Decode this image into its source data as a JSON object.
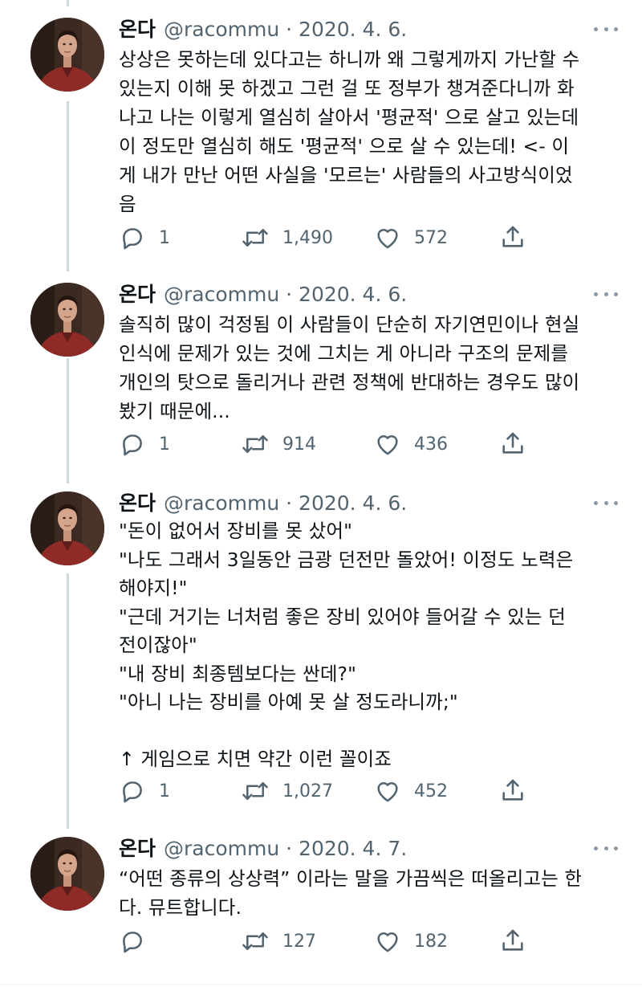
{
  "tweets": [
    {
      "name": "온다",
      "handle_date": "@racommu · 2020. 4. 6.",
      "text": "상상은 못하는데 있다고는 하니까 왜 그렇게까지 가난할 수\n있는지 이해 못 하겠고 그런 걸 또 정부가 챙겨준다니까 화\n나고 나는 이렇게 열심히 살아서 '평균적' 으로 살고 있는데\n이 정도만 열심히 해도 '평균적' 으로 살 수 있는데! <- 이\n게 내가 만난 어떤 사실을 '모르는' 사람들의 사고방식이었\n음",
      "replies": "1",
      "retweets": "1,490",
      "likes": "572"
    },
    {
      "name": "온다",
      "handle_date": "@racommu · 2020. 4. 6.",
      "text": "솔직히 많이 걱정됨 이 사람들이 단순히 자기연민이나 현실\n인식에 문제가 있는 것에 그치는 게 아니라 구조의 문제를\n개인의 탓으로 돌리거나 관련 정책에 반대하는 경우도 많이\n봤기 때문에...",
      "replies": "1",
      "retweets": "914",
      "likes": "436"
    },
    {
      "name": "온다",
      "handle_date": "@racommu · 2020. 4. 6.",
      "text": "\"돈이 없어서 장비를 못 샀어\"\n\"나도 그래서 3일동안 금광 던전만 돌았어! 이정도 노력은\n해야지!\"\n\"근데 거기는 너처럼 좋은 장비 있어야 들어갈 수 있는 던\n전이잖아\"\n\"내 장비 최종템보다는 싼데?\"\n\"아니 나는 장비를 아예 못 살 정도라니까;\"\n\n↑ 게임으로 치면 약간 이런 꼴이죠",
      "replies": "1",
      "retweets": "1,027",
      "likes": "452"
    },
    {
      "name": "온다",
      "handle_date": "@racommu · 2020. 4. 7.",
      "text": "“어떤 종류의 상상력” 이라는 말을 가끔씩은 떠올리고는 한\n다. 뮤트합니다.",
      "replies": "",
      "retweets": "127",
      "likes": "182"
    }
  ],
  "icons": {
    "reply": "reply-icon",
    "retweet": "retweet-icon",
    "like": "heart-icon",
    "share": "share-icon",
    "more": "more-icon",
    "avatar": "avatar-photo"
  },
  "colors": {
    "text": "#0f1419",
    "secondary": "#536471",
    "thread_line": "#cfd9de"
  }
}
